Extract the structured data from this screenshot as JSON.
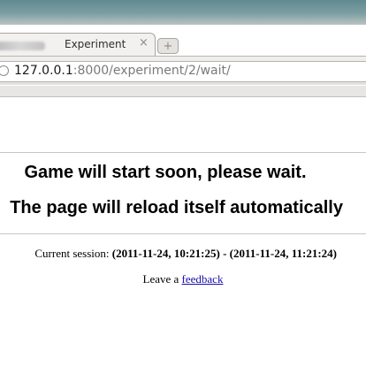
{
  "browser": {
    "tab": {
      "title": "Experiment",
      "close_glyph": "×"
    },
    "new_tab_glyph": "+",
    "address": {
      "host": "127.0.0.1",
      "rest": ":8000/experiment/2/wait/"
    }
  },
  "page": {
    "heading1": "Game will start soon, please wait.",
    "heading2": "The page will reload itself automatically",
    "session": {
      "label": "Current session:",
      "start": "(2011-11-24, 10:21:25)",
      "separator": "-",
      "end": "(2011-11-24, 11:21:24)"
    },
    "feedback": {
      "prefix": "Leave a",
      "link": "feedback"
    }
  },
  "icons": {
    "site": "globe-icon",
    "close": "close-icon",
    "new_tab": "plus-icon"
  }
}
